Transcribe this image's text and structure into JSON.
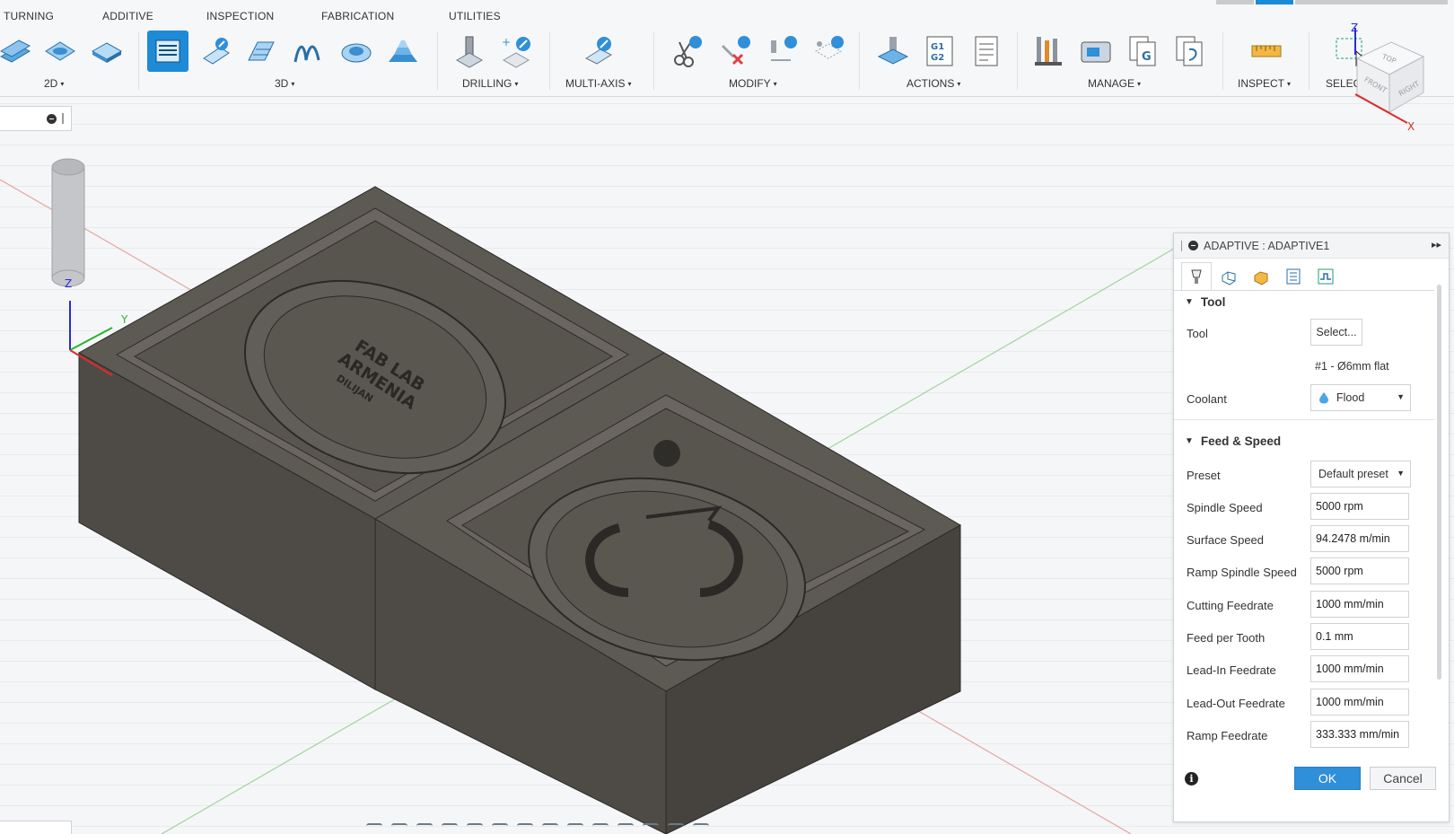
{
  "ribbon": {
    "tabs": [
      "TURNING",
      "ADDITIVE",
      "INSPECTION",
      "FABRICATION",
      "UTILITIES"
    ],
    "groups": [
      {
        "label": "2D",
        "has_caret": true
      },
      {
        "label": "3D",
        "has_caret": true
      },
      {
        "label": "DRILLING",
        "has_caret": true
      },
      {
        "label": "MULTI-AXIS",
        "has_caret": true
      },
      {
        "label": "MODIFY",
        "has_caret": true
      },
      {
        "label": "ACTIONS",
        "has_caret": true
      },
      {
        "label": "MANAGE",
        "has_caret": true
      },
      {
        "label": "INSPECT",
        "has_caret": true
      },
      {
        "label": "SELECT",
        "has_caret": true
      }
    ],
    "caret": "▾",
    "accent": "#1f8ad6"
  },
  "viewcube": {
    "faces": [
      "TOP",
      "FRONT",
      "RIGHT"
    ],
    "axes": [
      "Z",
      "X"
    ]
  },
  "triad": {
    "axes": [
      "Z",
      "Y"
    ]
  },
  "model": {
    "coin_text_lines": [
      "FAB LAB",
      "ARMENIA",
      "DILIJAN"
    ]
  },
  "panel": {
    "title": "ADAPTIVE : ADAPTIVE1",
    "expand_icon": "▸▸",
    "tabs": [
      "tool-tab-icon",
      "geometry-tab-icon",
      "heights-tab-icon",
      "passes-tab-icon",
      "linking-tab-icon"
    ],
    "tool_section": {
      "title": "Tool",
      "tool_label": "Tool",
      "select_button": "Select...",
      "tool_desc": "#1 - Ø6mm flat",
      "coolant_label": "Coolant",
      "coolant_value": "Flood"
    },
    "feed_section": {
      "title": "Feed & Speed",
      "preset_label": "Preset",
      "preset_value": "Default preset",
      "rows": [
        {
          "label": "Spindle Speed",
          "value": "5000 rpm"
        },
        {
          "label": "Surface Speed",
          "value": "94.2478 m/min"
        },
        {
          "label": "Ramp Spindle Speed",
          "value": "5000 rpm"
        },
        {
          "label": "Cutting Feedrate",
          "value": "1000 mm/min"
        },
        {
          "label": "Feed per Tooth",
          "value": "0.1 mm"
        },
        {
          "label": "Lead-In Feedrate",
          "value": "1000 mm/min"
        },
        {
          "label": "Lead-Out Feedrate",
          "value": "1000 mm/min"
        },
        {
          "label": "Ramp Feedrate",
          "value": "333.333 mm/min"
        }
      ]
    },
    "ok_label": "OK",
    "cancel_label": "Cancel",
    "info_icon": "i",
    "ok_color": "#2f8fd8"
  }
}
